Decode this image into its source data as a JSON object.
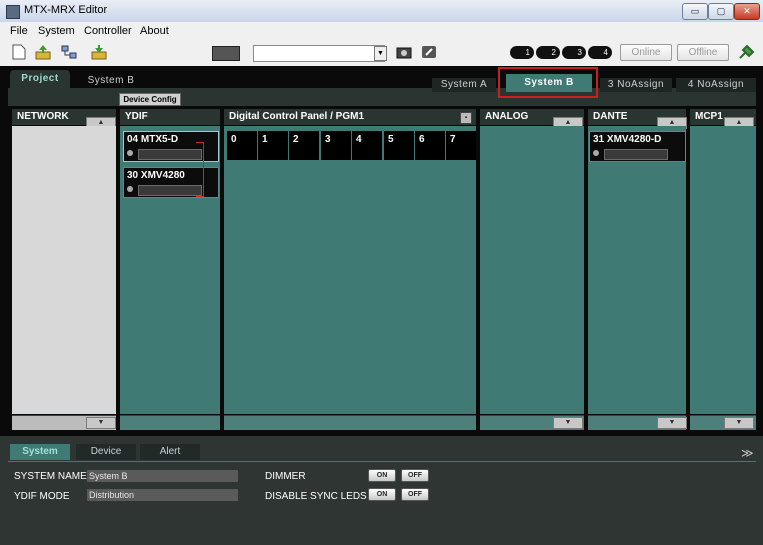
{
  "window": {
    "title": "MTX-MRX Editor",
    "btn_min": "▭",
    "btn_max": "▢",
    "btn_close": "✕"
  },
  "menu": [
    "File",
    "System",
    "Controller",
    "About"
  ],
  "toolbar": {
    "online_label": "Online",
    "offline_label": "Offline",
    "id_buttons": [
      "1",
      "2",
      "3",
      "4"
    ]
  },
  "project_tabs": {
    "project": "Project",
    "system_b": "System B"
  },
  "device_config_label": "Device Config",
  "system_tabs": [
    "System A",
    "System B",
    "3 NoAssign",
    "4 NoAssign"
  ],
  "columns": {
    "network": "NETWORK",
    "ydif": "YDIF",
    "dcp": "Digital Control Panel / PGM1",
    "analog": "ANALOG",
    "dante": "DANTE",
    "mcp1": "MCP1"
  },
  "devices": {
    "ydif_1": "04 MTX5-D",
    "ydif_2": "30 XMV4280",
    "dante_1": "31 XMV4280-D"
  },
  "dcp_slots": [
    "0",
    "1",
    "2",
    "3",
    "4",
    "5",
    "6",
    "7"
  ],
  "bottom_tabs": [
    "System",
    "Device",
    "Alert"
  ],
  "properties": {
    "system_name_label": "SYSTEM NAME",
    "system_name_value": "System B",
    "ydif_mode_label": "YDIF MODE",
    "ydif_mode_value": "Distribution",
    "dimmer_label": "DIMMER",
    "disable_sync_leds_label": "DISABLE SYNC LEDS",
    "on_label": "ON",
    "off_label": "OFF"
  },
  "colors": {
    "accent": "#3f7a74",
    "highlight": "#cc1f1f",
    "background": "#0a0a0a"
  }
}
